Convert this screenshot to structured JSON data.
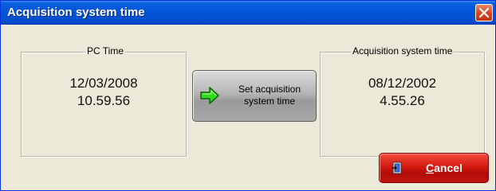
{
  "window": {
    "title": "Acquisition system time"
  },
  "pc_time": {
    "legend": "PC Time",
    "date": "12/03/2008",
    "time": "10.59.56"
  },
  "acq_time": {
    "legend": "Acquisition system time",
    "date": "08/12/2002",
    "time": "4.55.26"
  },
  "set_button": {
    "line1": "Set acquisition",
    "line2": "system time",
    "icon": "green-arrow-right-icon"
  },
  "cancel_button": {
    "mnemonic": "C",
    "rest": "ancel",
    "icon": "exit-door-icon"
  },
  "colors": {
    "titlebar": "#0155d6",
    "cancel": "#d61a12",
    "arrow": "#2fdc1a"
  }
}
